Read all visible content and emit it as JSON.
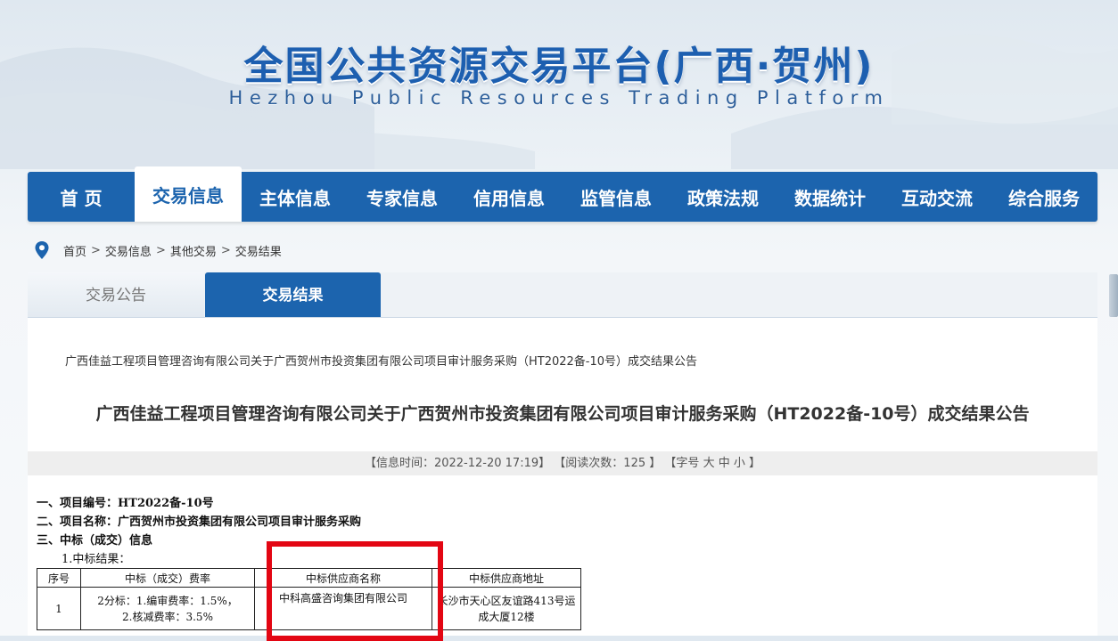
{
  "site": {
    "title": "全国公共资源交易平台(广西·贺州)",
    "subtitle": "Hezhou Public Resources Trading Platform"
  },
  "nav": {
    "items": [
      {
        "label": "首 页",
        "name": "nav-home"
      },
      {
        "label": "交易信息",
        "name": "nav-trade-info",
        "active": true
      },
      {
        "label": "主体信息",
        "name": "nav-entity-info"
      },
      {
        "label": "专家信息",
        "name": "nav-expert-info"
      },
      {
        "label": "信用信息",
        "name": "nav-credit-info"
      },
      {
        "label": "监管信息",
        "name": "nav-supervision-info"
      },
      {
        "label": "政策法规",
        "name": "nav-policy"
      },
      {
        "label": "数据统计",
        "name": "nav-statistics"
      },
      {
        "label": "互动交流",
        "name": "nav-interaction"
      },
      {
        "label": "综合服务",
        "name": "nav-services"
      }
    ],
    "color": "#1c64ae"
  },
  "breadcrumb": {
    "icon": "location-pin-icon",
    "items": [
      "首页",
      "交易信息",
      "其他交易",
      "交易结果"
    ],
    "separator": ">"
  },
  "tabs": {
    "tab1": "交易公告",
    "tab2": "交易结果"
  },
  "article": {
    "small_title": "广西佳益工程项目管理咨询有限公司关于广西贺州市投资集团有限公司项目审计服务采购（HT2022备-10号）成交结果公告",
    "title": "广西佳益工程项目管理咨询有限公司关于广西贺州市投资集团有限公司项目审计服务采购（HT2022备-10号）成交结果公告",
    "info": {
      "time_label": "【信息时间：",
      "time": "2022-12-20 17:19",
      "time_end": "】",
      "views_label": "【阅读次数：",
      "views": "125",
      "views_end": " 】",
      "font_label": "【字号",
      "font_large": "大",
      "font_medium": "中",
      "font_small": "小",
      "font_end": "】"
    },
    "lines": {
      "line1": "一、项目编号：HT2022备-10号",
      "line2": "二、项目名称：广西贺州市投资集团有限公司项目审计服务采购",
      "line3": "三、中标（成交）信息",
      "line4": "1.中标结果："
    },
    "table": {
      "headers": [
        "序号",
        "中标（成交）费率",
        "中标供应商名称",
        "中标供应商地址"
      ],
      "row": {
        "index": "1",
        "rate_line1": "2分标：1.编审费率：1.5%，",
        "rate_line2": "2.核减费率：3.5%",
        "supplier": "中科高盛咨询集团有限公司",
        "address": "长沙市天心区友谊路413号运成大厦12楼"
      }
    },
    "highlight_color": "#e30613"
  }
}
